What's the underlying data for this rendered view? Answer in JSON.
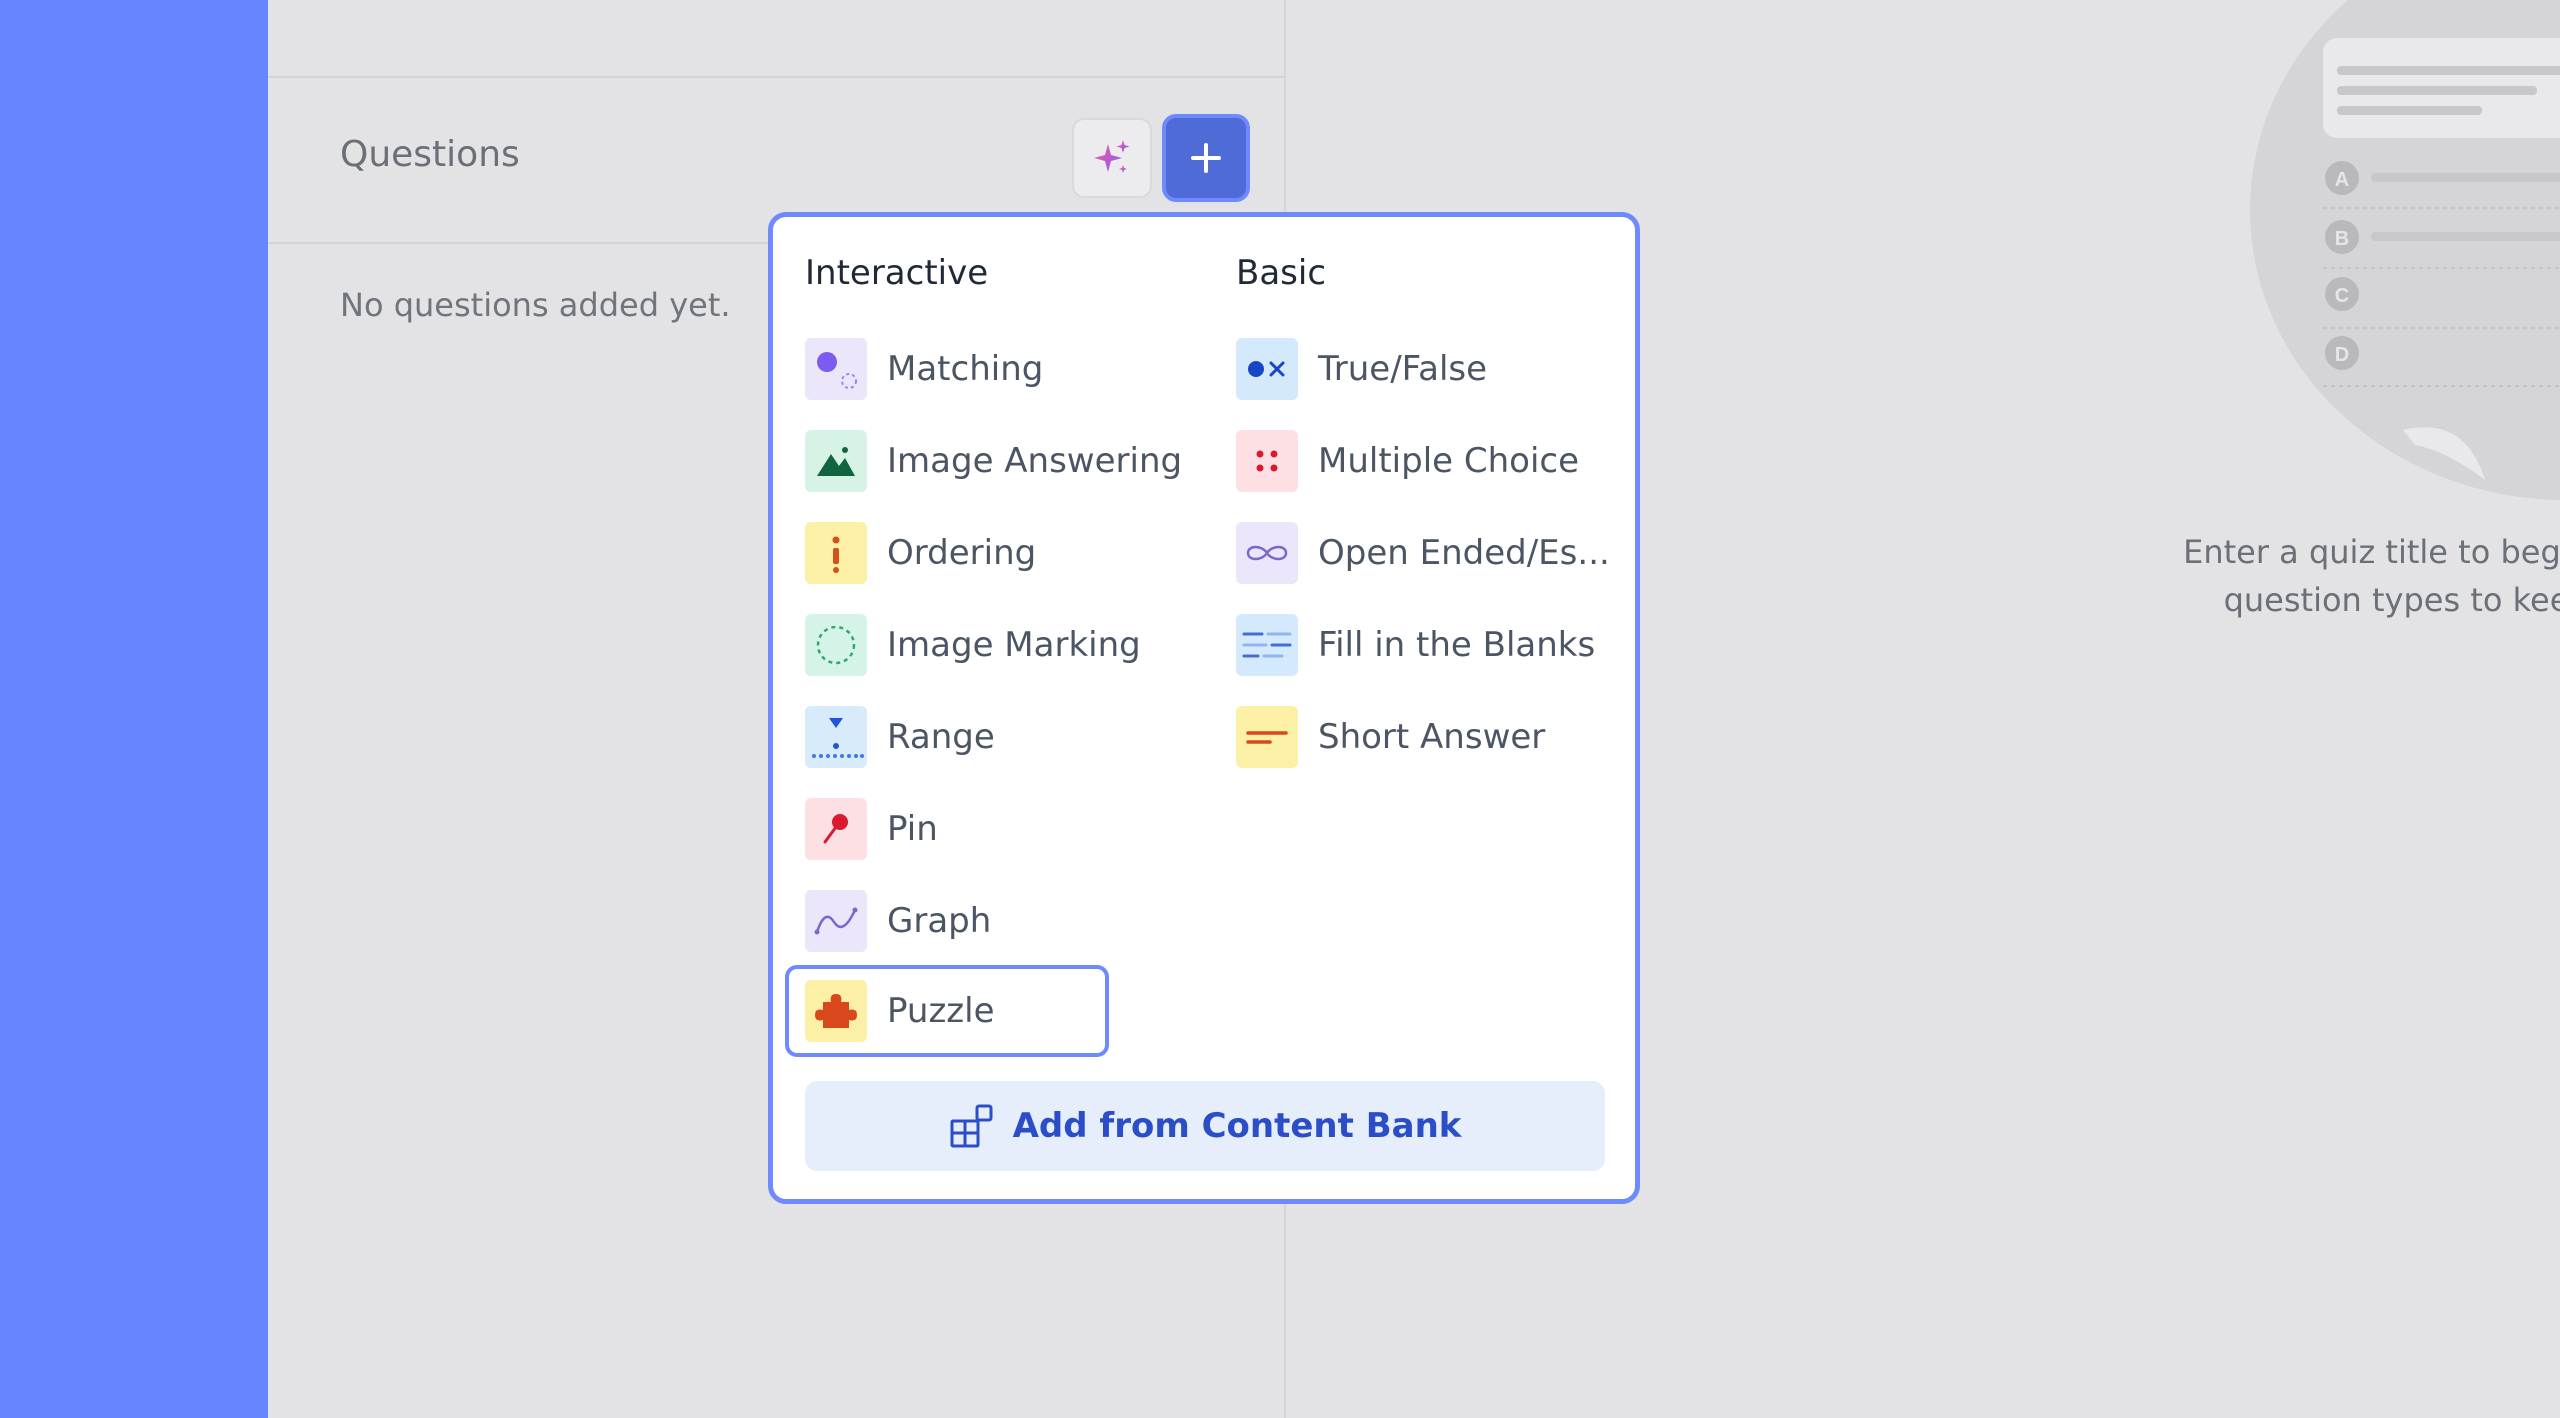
{
  "panel": {
    "title": "Questions",
    "empty_text": "No questions added yet."
  },
  "hint": {
    "line1": "Enter a quiz title to begin. Ch",
    "line2": "question types to keep t",
    "options": [
      "A",
      "B",
      "C",
      "D"
    ]
  },
  "menu": {
    "interactive_heading": "Interactive",
    "basic_heading": "Basic",
    "interactive_items": [
      {
        "label": "Matching",
        "icon": "matching-icon"
      },
      {
        "label": "Image Answering",
        "icon": "image-answering-icon"
      },
      {
        "label": "Ordering",
        "icon": "ordering-icon"
      },
      {
        "label": "Image Marking",
        "icon": "image-marking-icon"
      },
      {
        "label": "Range",
        "icon": "range-icon"
      },
      {
        "label": "Pin",
        "icon": "pin-icon"
      },
      {
        "label": "Graph",
        "icon": "graph-icon"
      },
      {
        "label": "Puzzle",
        "icon": "puzzle-icon"
      }
    ],
    "basic_items": [
      {
        "label": "True/False",
        "icon": "true-false-icon"
      },
      {
        "label": "Multiple Choice",
        "icon": "multiple-choice-icon"
      },
      {
        "label": "Open Ended/Es...",
        "icon": "open-ended-icon"
      },
      {
        "label": "Fill in the Blanks",
        "icon": "fill-blanks-icon"
      },
      {
        "label": "Short Answer",
        "icon": "short-answer-icon"
      }
    ],
    "selected": "Puzzle",
    "bank_label": "Add from Content Bank"
  },
  "colors": {
    "sidebar": "#6685ff",
    "accent": "#6f89ff",
    "primary_button": "#4f6bd8",
    "bank_text": "#2b4ec8"
  }
}
